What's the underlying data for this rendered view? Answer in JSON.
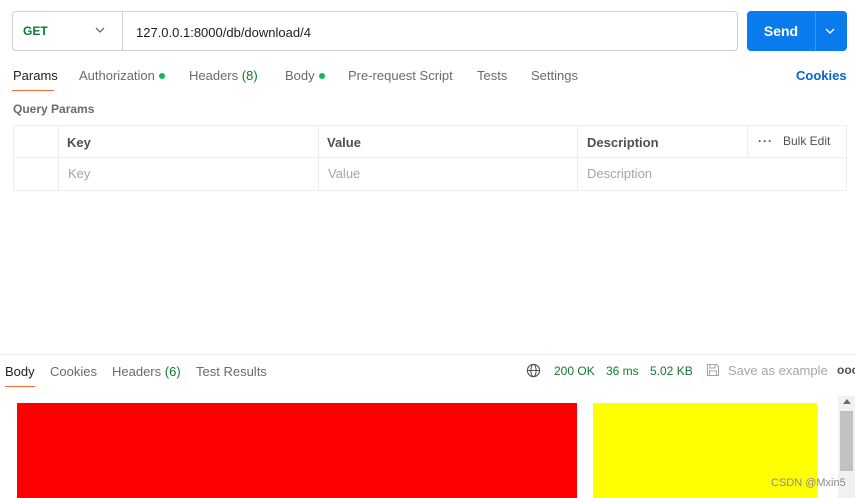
{
  "request": {
    "method": "GET",
    "url": "127.0.0.1:8000/db/download/4",
    "send_label": "Send"
  },
  "tabs": {
    "params": "Params",
    "authorization": "Authorization",
    "headers": "Headers",
    "headers_count": "(8)",
    "body": "Body",
    "pre_request": "Pre-request Script",
    "tests": "Tests",
    "settings": "Settings",
    "cookies": "Cookies"
  },
  "query_params": {
    "title": "Query Params",
    "columns": {
      "key": "Key",
      "value": "Value",
      "description": "Description"
    },
    "bulk_edit": "Bulk Edit",
    "row_placeholders": {
      "key": "Key",
      "value": "Value",
      "description": "Description"
    }
  },
  "response": {
    "tabs": {
      "body": "Body",
      "cookies": "Cookies",
      "headers": "Headers",
      "headers_count": "(6)",
      "test_results": "Test Results"
    },
    "status": "200 OK",
    "time": "36 ms",
    "size": "5.02 KB",
    "save_as_example": "Save as example",
    "more": "ooo"
  },
  "preview": {
    "red_color": "#ff0000",
    "yellow_color": "#ffff00"
  },
  "watermark": "CSDN @Mxin5",
  "colors": {
    "accent": "#ff6c37",
    "send_button": "#097bed",
    "method_get": "#0b7a30",
    "status_ok": "#0b7a30",
    "link": "#0265d2"
  }
}
